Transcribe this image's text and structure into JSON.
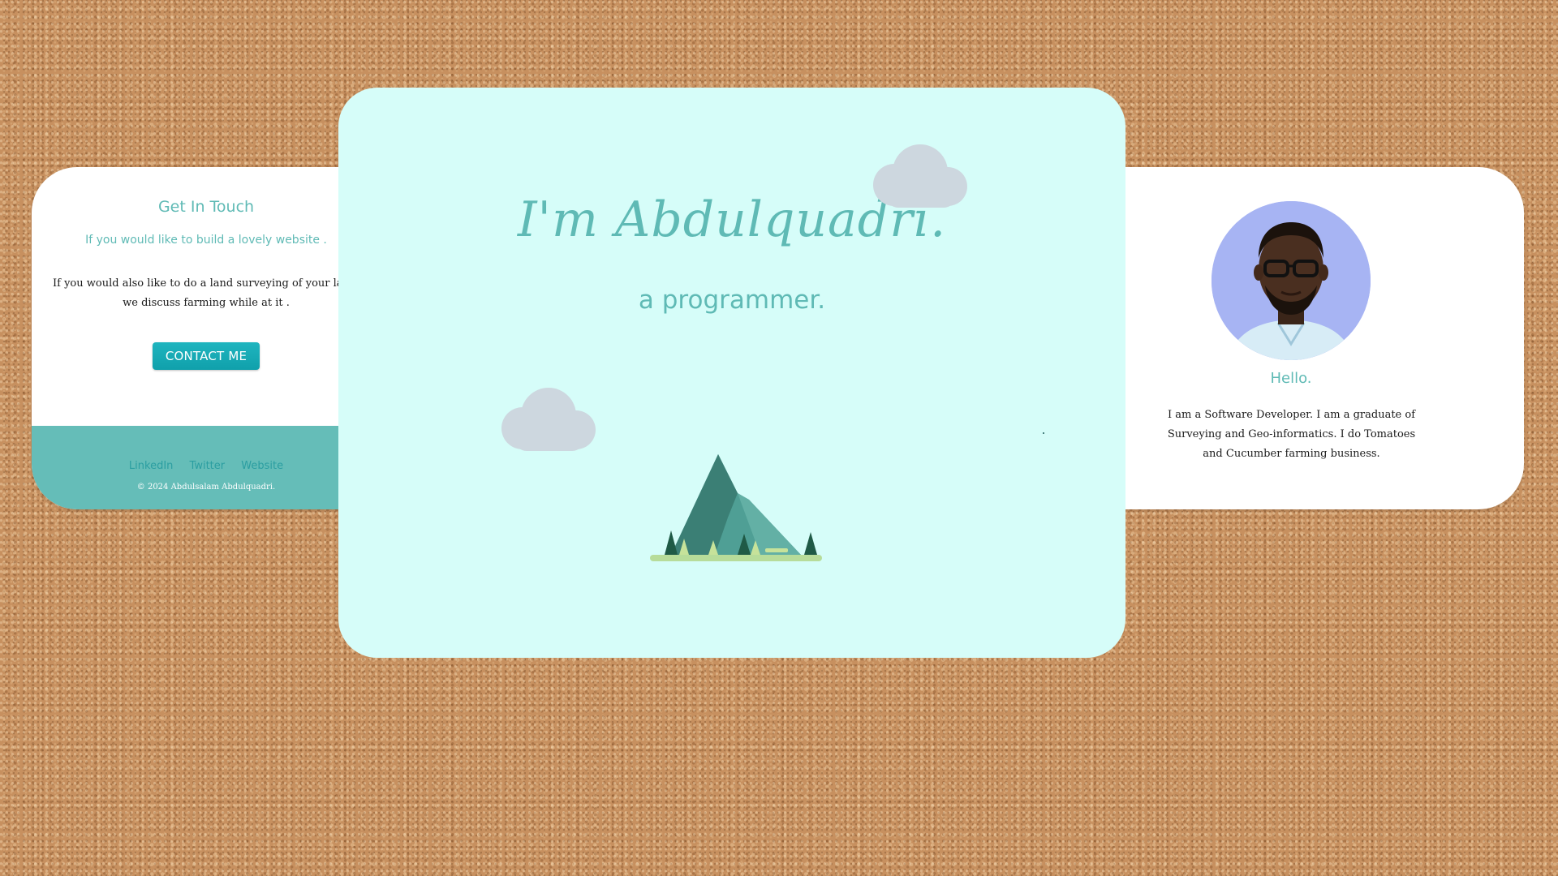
{
  "contact_card": {
    "title": "Get In Touch",
    "subtitle": "If you would like to build a lovely website .",
    "text_line1": "If you would also like to do a land surveying of your land, a",
    "text_line2": "we discuss farming while at it .",
    "button_label": "CONTACT ME",
    "footer": {
      "links": [
        "LinkedIn",
        "Twitter",
        "Website"
      ],
      "copyright": "© 2024 Abdulsalam Abdulquadri."
    }
  },
  "hero": {
    "title": "I'm Abdulquadri.",
    "subtitle": "a programmer.",
    "illustrations": [
      "cloud-icon",
      "cloud-icon",
      "mountain-icon"
    ]
  },
  "about_card": {
    "avatar_icon": "profile-photo",
    "title": "Hello.",
    "text_line1": "I am a Software Developer. I am a graduate of",
    "text_line2": "Surveying and Geo-informatics. I do Tomatoes",
    "text_line3": "and Cucumber farming business."
  },
  "colors": {
    "accent": "#5fbab5",
    "button": "#16a9b3",
    "hero_background": "#d6fdf9",
    "footer_background": "#65bdb8",
    "cork_background": "#c7905f"
  }
}
